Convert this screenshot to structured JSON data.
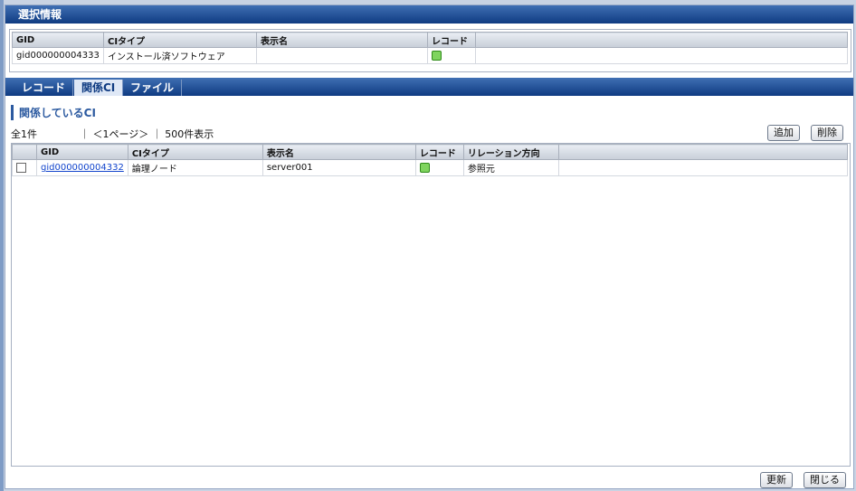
{
  "selection": {
    "title": "選択情報",
    "columns": [
      "GID",
      "CIタイプ",
      "表示名",
      "レコード"
    ],
    "row": {
      "gid": "gid000000004333",
      "ci_type": "インストール済ソフトウェア",
      "display_name": "",
      "record_icon": "record-icon"
    }
  },
  "tabs": [
    {
      "label": "レコード"
    },
    {
      "label": "関係CI",
      "active": true
    },
    {
      "label": "ファイル"
    }
  ],
  "related": {
    "title": "関係しているCI",
    "count": "全1件",
    "page": "｜ ＜1ページ＞ ｜ 500件表示",
    "add_label": "追加",
    "delete_label": "削除",
    "columns": [
      "GID",
      "CIタイプ",
      "表示名",
      "レコード",
      "リレーション方向"
    ],
    "row": {
      "gid": "gid000000004332",
      "ci_type": "論理ノード",
      "display_name": "server001",
      "record_icon": "record-icon",
      "direction": "参照元"
    }
  },
  "footer": {
    "refresh_label": "更新",
    "close_label": "閉じる"
  },
  "colors": {
    "header_blue": "#0f3b82",
    "accent": "#2c5aa0",
    "record_green": "#7fd45e"
  }
}
